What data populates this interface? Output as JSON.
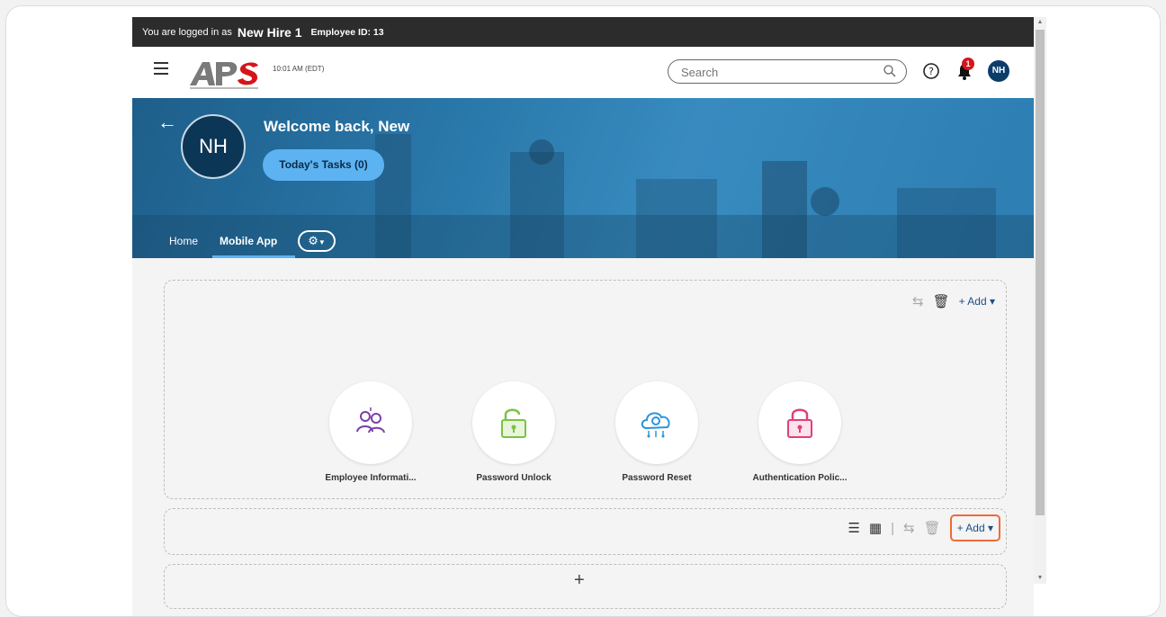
{
  "login_bar": {
    "prefix": "You are logged in as",
    "user_name": "New Hire 1",
    "employee_id": "Employee ID: 13"
  },
  "topnav": {
    "time": "10:01 AM (EDT)",
    "search_placeholder": "Search",
    "notification_count": "1",
    "avatar_initials": "NH"
  },
  "hero": {
    "avatar_initials": "NH",
    "welcome": "Welcome back, New",
    "tasks_button": "Today's Tasks (0)",
    "tabs": [
      {
        "label": "Home",
        "active": false
      },
      {
        "label": "Mobile App",
        "active": true
      }
    ]
  },
  "panel_toolbar": {
    "add_label": "+ Add"
  },
  "tiles": [
    {
      "label": "Employee Informati...",
      "icon": "people-icon",
      "color": "#7b3fa8"
    },
    {
      "label": "Password Unlock",
      "icon": "lock-open-icon",
      "color": "#7cc242"
    },
    {
      "label": "Password Reset",
      "icon": "cloud-gear-icon",
      "color": "#2a95d8"
    },
    {
      "label": "Authentication Polic...",
      "icon": "lock-icon",
      "color": "#e0407a"
    }
  ],
  "colors": {
    "accent": "#5db3f2",
    "brand_dark": "#0b3d6b",
    "highlight": "#ef6a3a",
    "badge": "#d6141b"
  }
}
